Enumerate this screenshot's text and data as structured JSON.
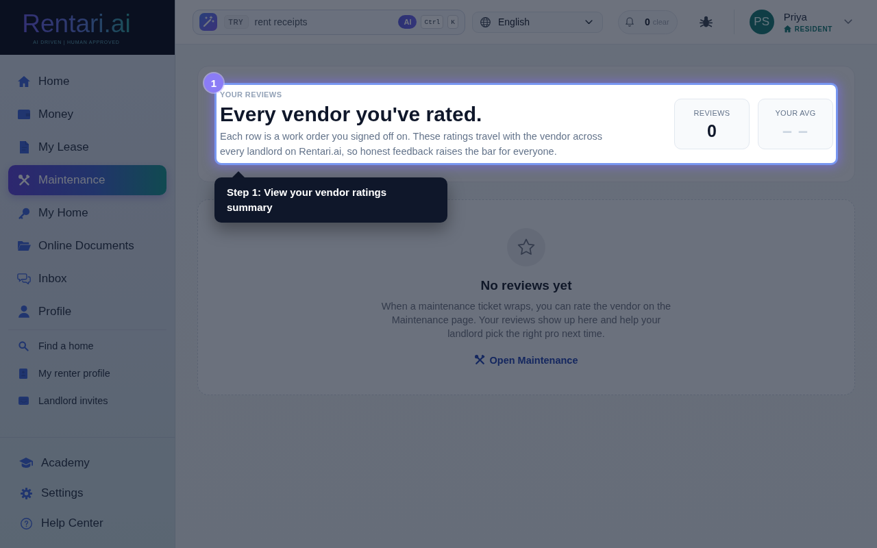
{
  "brand": {
    "logo": "Rentari.ai",
    "tagline": "AI DRIVEN | HUMAN APPROVED"
  },
  "sidebar": {
    "primary_items": [
      {
        "label": "Home",
        "selected": false
      },
      {
        "label": "Money",
        "selected": false
      },
      {
        "label": "My Lease",
        "selected": false
      },
      {
        "label": "Maintenance",
        "selected": true
      },
      {
        "label": "My Home",
        "selected": false
      },
      {
        "label": "Online Documents",
        "selected": false
      },
      {
        "label": "Inbox",
        "selected": false
      },
      {
        "label": "Profile",
        "selected": false
      }
    ],
    "secondary_items": [
      {
        "label": "Find a home",
        "selected": false
      },
      {
        "label": "My renter profile",
        "selected": false
      },
      {
        "label": "Landlord invites",
        "selected": false
      }
    ],
    "footer_items": [
      {
        "label": "Academy",
        "selected": false
      },
      {
        "label": "Settings",
        "selected": false
      },
      {
        "label": "Help Center",
        "selected": false
      }
    ]
  },
  "top_bar": {
    "search": {
      "prompt_tag": "TRY",
      "placeholder": "rent receipts",
      "ai_tag": "AI",
      "shortcut_keys": [
        "Ctrl",
        "K"
      ]
    },
    "language": {
      "value": "English"
    },
    "notifications": {
      "count": "0",
      "action": "clear"
    },
    "user": {
      "initials": "PS",
      "name": "Priya",
      "role": "RESIDENT"
    }
  },
  "reviews_summary": {
    "eyebrow": "YOUR REVIEWS",
    "title": "Every vendor you've rated.",
    "description": "Each row is a work order you signed off on. These ratings travel with the vendor across every landlord on Rentari.ai, so honest feedback raises the bar for everyone.",
    "stats": [
      {
        "label": "REVIEWS",
        "value": "0",
        "kind": "count"
      },
      {
        "label": "YOUR AVG",
        "value": "– –",
        "kind": "placeholder"
      }
    ]
  },
  "tour": {
    "step": "1",
    "tooltip": "Step 1: View your vendor ratings summary"
  },
  "empty_state": {
    "title": "No reviews yet",
    "description": "When a maintenance ticket wraps, you can rate the vendor on the Maintenance page. Your reviews show up here and help your landlord pick the right pro next time.",
    "link": "Open Maintenance"
  }
}
